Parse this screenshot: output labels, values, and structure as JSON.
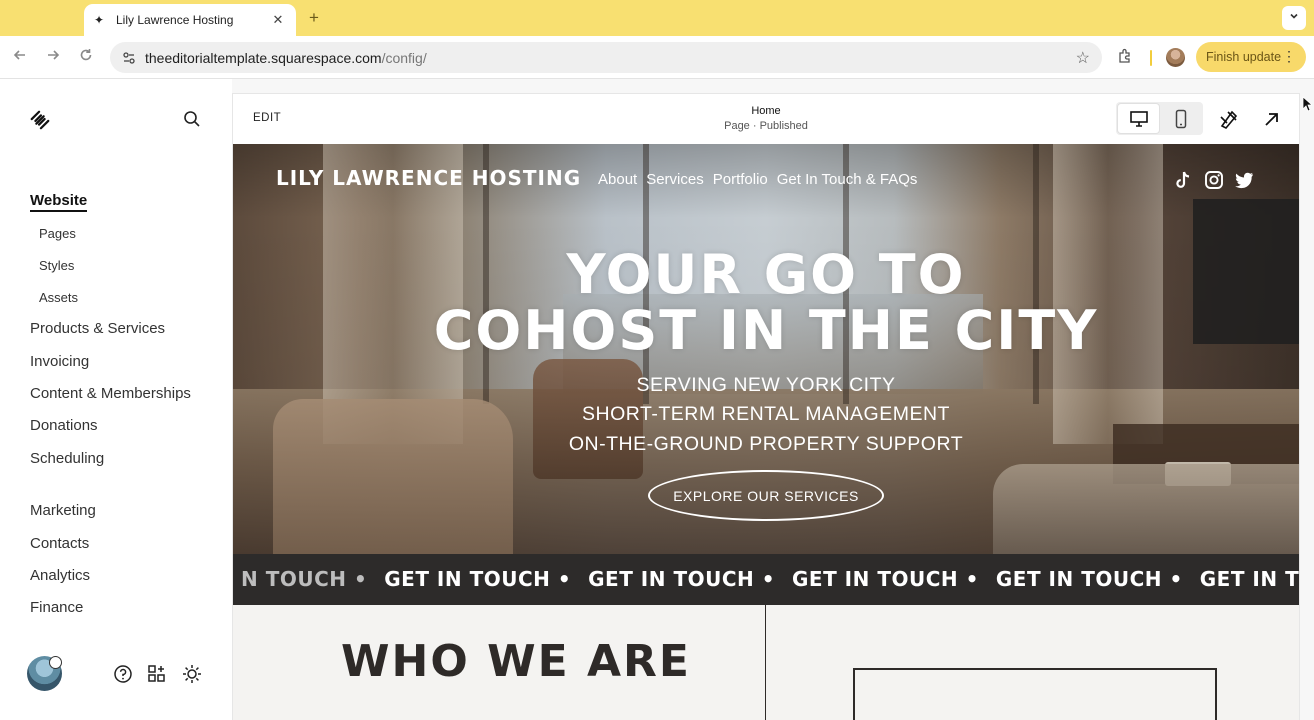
{
  "browser": {
    "tab_title": "Lily Lawrence Hosting",
    "url_host": "theeditorialtemplate.squarespace.com",
    "url_path": "/config/",
    "update_label": "Finish update"
  },
  "sidebar": {
    "website": "Website",
    "sub": [
      "Pages",
      "Styles",
      "Assets"
    ],
    "main": [
      "Products & Services",
      "Invoicing",
      "Content & Memberships",
      "Donations",
      "Scheduling"
    ],
    "secondary": [
      "Marketing",
      "Contacts",
      "Analytics",
      "Finance"
    ]
  },
  "editor": {
    "edit_label": "EDIT",
    "page_name": "Home",
    "page_status": "Page · Published"
  },
  "site": {
    "title": "LILY LAWRENCE HOSTING",
    "nav": [
      "About",
      "Services",
      "Portfolio",
      "Get In Touch & FAQs"
    ],
    "hero_line1": "YOUR GO TO",
    "hero_line2": "COHOST IN THE CITY",
    "sub1": "SERVING NEW YORK CITY",
    "sub2": "SHORT-TERM RENTAL MANAGEMENT",
    "sub3": "ON-THE-GROUND PROPERTY SUPPORT",
    "cta": "EXPLORE OUR SERVICES",
    "marquee_first": "N TOUCH •",
    "marquee_item": "GET IN TOUCH •",
    "marquee_last": "GET IN TOUC",
    "section_heading": "WHO WE ARE"
  },
  "colors": {
    "chrome_yellow": "#f8e071",
    "update_pill": "#f8d96a",
    "marquee_bg": "#2d2b2a",
    "section_bg": "#f4f3f1"
  }
}
